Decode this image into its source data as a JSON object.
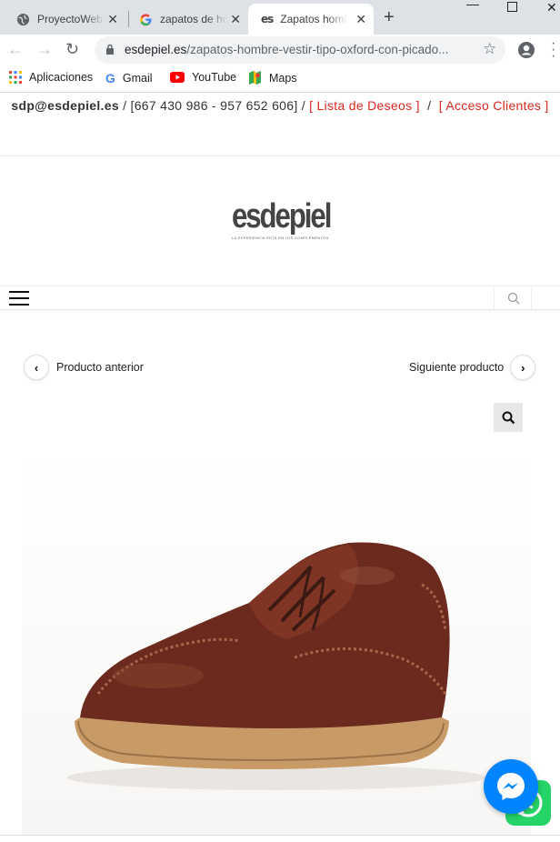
{
  "browser": {
    "tabs": [
      {
        "title": "ProyectoWeb",
        "icon": "globe-icon"
      },
      {
        "title": "zapatos de hombre",
        "icon": "google-icon"
      },
      {
        "title": "Zapatos hombre",
        "icon": "es-favicon",
        "favicon_text": "es",
        "active": true
      }
    ],
    "url_domain": "esdepiel.es",
    "url_path": "/zapatos-hombre-vestir-tipo-oxford-con-picado...",
    "bookmarks": [
      {
        "label": "Aplicaciones",
        "icon": "apps-grid-icon"
      },
      {
        "label": "Gmail",
        "icon": "google-icon"
      },
      {
        "label": "YouTube",
        "icon": "youtube-icon"
      },
      {
        "label": "Maps",
        "icon": "maps-icon"
      }
    ]
  },
  "topbar": {
    "email": "sdp@esdepiel.es",
    "sep1": " / ",
    "phones": "[667 430 986 - 957 652 606]",
    "sep2": " / ",
    "wishlist": "[ Lista de Deseos ]",
    "sep3": "  /  ",
    "login": "[ Acceso Clientes ]"
  },
  "logo": {
    "text": "esdepiel",
    "tagline": "LA EXPERIENCIA ESTÁ EN LOS COMPLEMENTOS"
  },
  "product_nav": {
    "prev_label": "Producto anterior",
    "next_label": "Siguiente producto"
  },
  "colors": {
    "accent_red": "#d8271c",
    "messenger_blue": "#0084ff",
    "whatsapp_green": "#25d366"
  }
}
